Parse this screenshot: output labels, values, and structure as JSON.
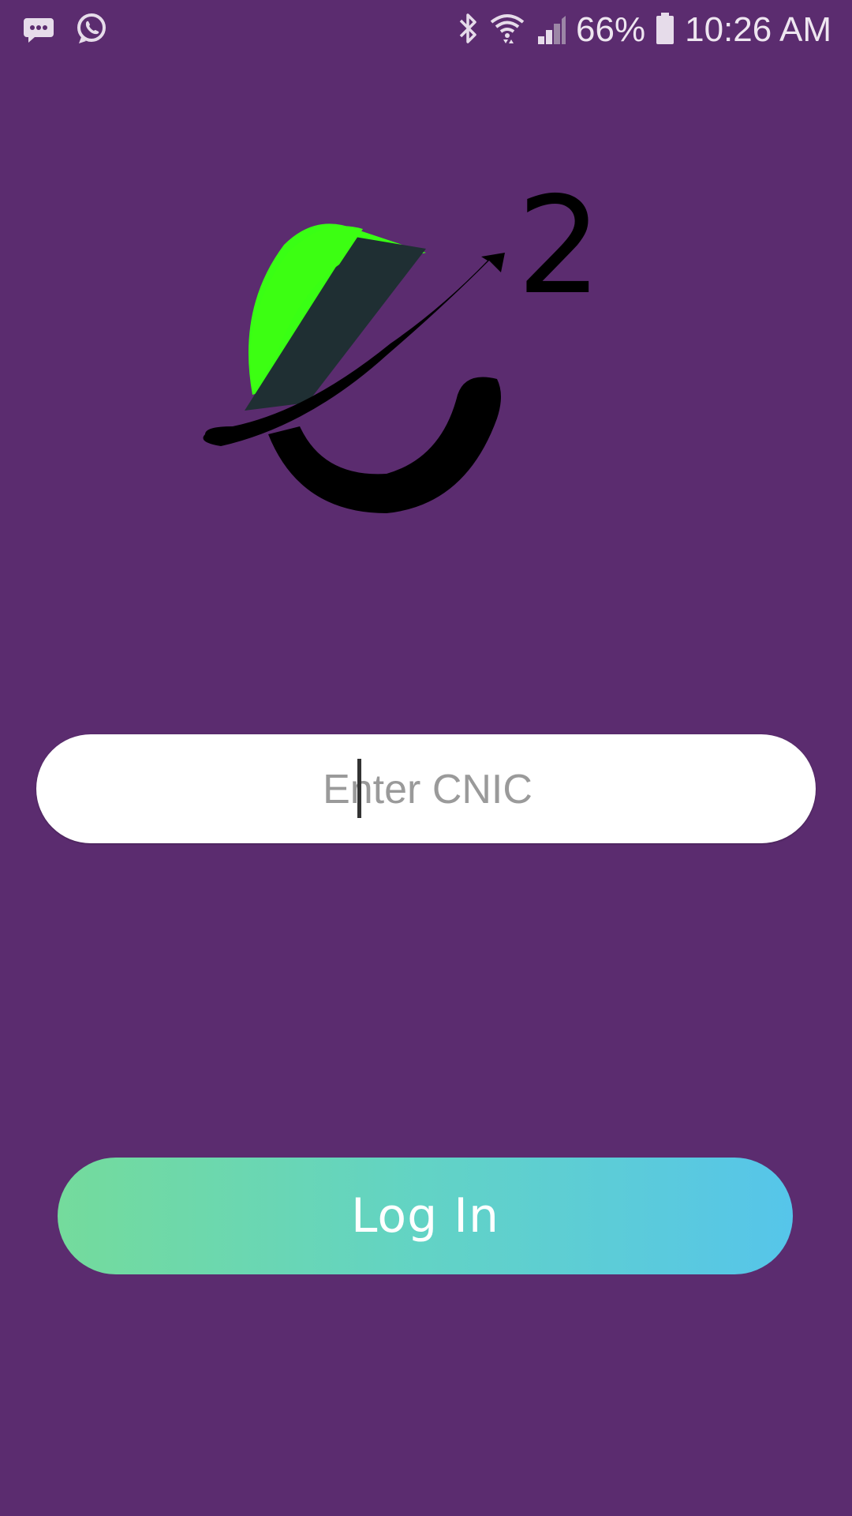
{
  "status_bar": {
    "battery_percent": "66%",
    "time": "10:26 AM",
    "icons": [
      "messaging-icon",
      "whatsapp-icon",
      "bluetooth-icon",
      "wifi-icon",
      "cell-signal-icon",
      "battery-icon"
    ]
  },
  "logo": {
    "superscript": "2",
    "colors": {
      "green": "#39ff14",
      "dark": "#1f2f33",
      "black": "#000000"
    }
  },
  "form": {
    "cnic_placeholder": "Enter CNIC",
    "cnic_value": ""
  },
  "actions": {
    "login_label": "Log In"
  },
  "colors": {
    "background": "#5b2c6f",
    "button_gradient_start": "#74db9c",
    "button_gradient_end": "#56c5ea"
  }
}
